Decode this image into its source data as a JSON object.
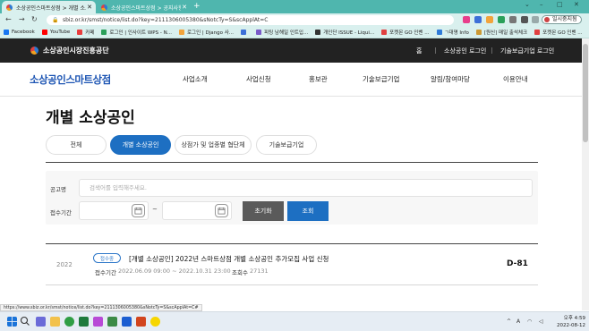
{
  "browser": {
    "tabs": [
      {
        "title": "소상공인스마트상점 > 개별 소...",
        "active": true
      },
      {
        "title": "소상공인스마트상점 > 공지사항...",
        "active": false
      }
    ],
    "new_tab": "+",
    "window_controls": [
      "⌄",
      "–",
      "□",
      "✕"
    ],
    "nav": {
      "back": "←",
      "forward": "→",
      "reload": "↻"
    },
    "url": "sbiz.or.kr/smst/notice/list.do?key=2111306005380&sNotcTy=S&scApplAt=C",
    "profile_label": "일시중지됨",
    "bookmarks": [
      {
        "label": "Facebook",
        "color": "#1877f2"
      },
      {
        "label": "YouTube",
        "color": "#ff0000"
      },
      {
        "label": "카페",
        "color": "#e83e3e"
      },
      {
        "label": "로그인 | 인사이트 WPS - N...",
        "color": "#2aa05a"
      },
      {
        "label": "로그인 | Django 사...",
        "color": "#f2a33b"
      },
      {
        "label": "",
        "color": "#3c6fd8"
      },
      {
        "label": "피팅 남해일 인트입...",
        "color": "#7a5ac8"
      },
      {
        "label": "개인단 ISSUE - Liqui...",
        "color": "#333333"
      },
      {
        "label": "포켓몬 GO 인벤 ...",
        "color": "#e04040"
      },
      {
        "label": "ㄱ대명 Info",
        "color": "#2f7bd8"
      },
      {
        "label": "[원신] 매일 출석체크",
        "color": "#cc9a35"
      },
      {
        "label": "포켓몬 GO 인벤 ...",
        "color": "#e04040"
      }
    ]
  },
  "site": {
    "org_name": "소상공인시장진흥공단",
    "top_links": [
      "홈",
      "소상공인 로그인",
      "기술보급기업 로그인"
    ],
    "brand": "소상공인스마트상점",
    "menu": [
      "사업소개",
      "사업신청",
      "홍보관",
      "기술보급기업",
      "알림/참여마당",
      "이용안내"
    ]
  },
  "page": {
    "title": "개별 소상공인",
    "tabs": [
      {
        "label": "전체",
        "active": false
      },
      {
        "label": "개별 소상공인",
        "active": true
      },
      {
        "label": "상점가 및 업종별 협단체",
        "active": false
      },
      {
        "label": "기술보급기업",
        "active": false
      }
    ]
  },
  "search": {
    "keyword_label": "공고명",
    "keyword_placeholder": "검색어를 입력해주세요.",
    "period_label": "접수기간",
    "date_start": "",
    "date_end": "",
    "tilde": "~",
    "reset_label": "초기화",
    "submit_label": "조회"
  },
  "notice": {
    "year": "2022",
    "badge": "접수중",
    "title": "[개별 소상공인] 2022년 스마트상점 개별 소상공인 추가모집 사업 신청",
    "period_label": "접수기간",
    "period": "2022.06.09 09:00 ~ 2022.10.31 23:00",
    "views_label": "조회수",
    "views": "27131",
    "dday": "D-81"
  },
  "status_link": "https://www.sbiz.or.kr/smst/notice/list.do?key=2111306005380&sNotcTy=S&scApplAt=C#",
  "taskbar": {
    "tray_up": "^",
    "ime": "A",
    "time": "오후 4:59",
    "date": "2022-08-12"
  },
  "colors": {
    "brand_blue": "#1d55b3",
    "accent_blue": "#1d6fc2",
    "chrome_teal": "#4fb6ae",
    "reset_gray": "#5a5a5a"
  }
}
